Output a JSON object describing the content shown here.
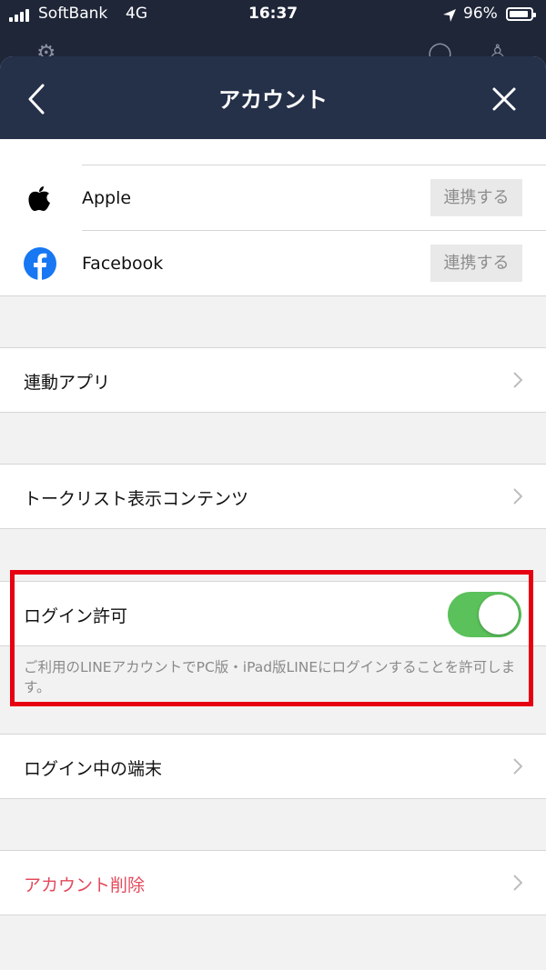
{
  "status_bar": {
    "carrier": "SoftBank",
    "network": "4G",
    "time": "16:37",
    "battery": "96%",
    "battery_level": 96
  },
  "header": {
    "title": "アカウント",
    "back_icon": "chevron-left-icon",
    "close_icon": "close-icon"
  },
  "linked_accounts": [
    {
      "name": "Apple",
      "icon": "apple-icon",
      "button": "連携する"
    },
    {
      "name": "Facebook",
      "icon": "facebook-icon",
      "button": "連携する"
    }
  ],
  "menu": {
    "linked_apps": "連動アプリ",
    "talk_list_content": "トークリスト表示コンテンツ",
    "login_devices": "ログイン中の端末",
    "delete_account": "アカウント削除"
  },
  "login_permission": {
    "label": "ログイン許可",
    "enabled": true,
    "description": "ご利用のLINEアカウントでPC版・iPad版LINEにログインすることを許可します。"
  },
  "colors": {
    "navbar": "#253049",
    "toggle_on": "#5bc15b",
    "highlight": "#e60012",
    "danger_text": "#e34a5c",
    "facebook": "#1877f2"
  }
}
